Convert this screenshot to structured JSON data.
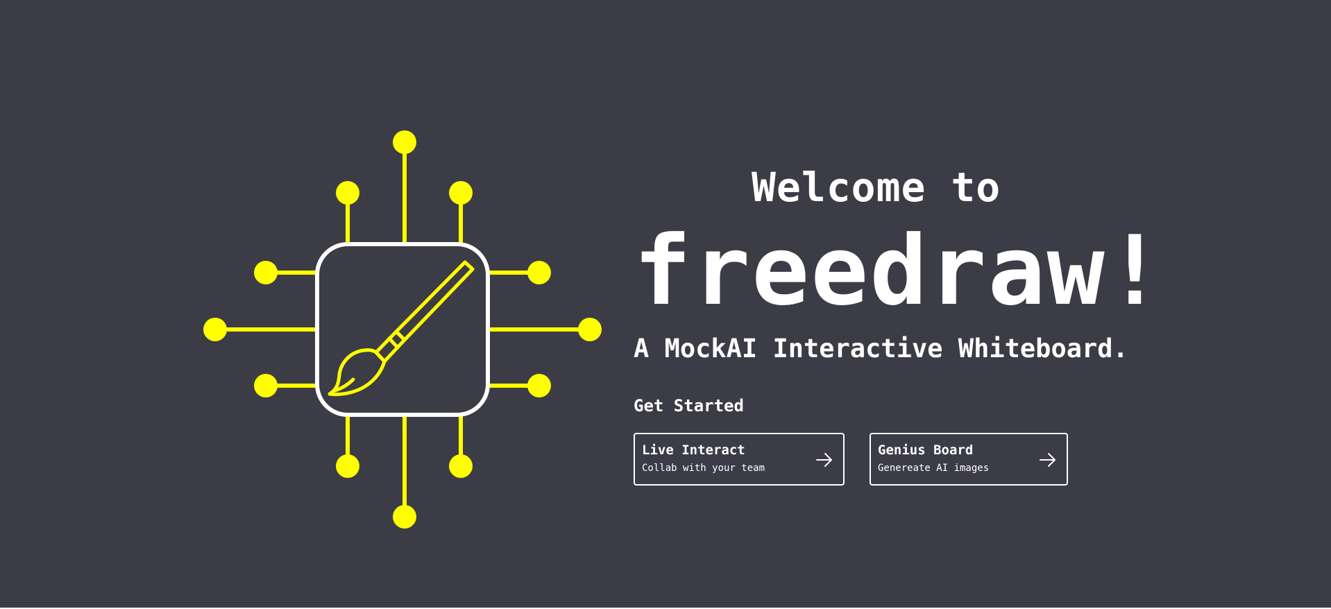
{
  "hero": {
    "welcome": "Welcome to",
    "brand": "freedraw!",
    "tagline": "A MockAI Interactive Whiteboard.",
    "get_started": "Get Started"
  },
  "cards": [
    {
      "title": "Live Interact",
      "subtitle": "Collab with your team",
      "icon": "arrow-right-icon"
    },
    {
      "title": "Genius Board",
      "subtitle": "Genereate AI images",
      "icon": "arrow-right-icon"
    }
  ],
  "logo": {
    "icon": "paintbrush-chip-icon"
  },
  "colors": {
    "background": "#3c3c47",
    "accent": "#ffff00",
    "text": "#ffffff"
  }
}
